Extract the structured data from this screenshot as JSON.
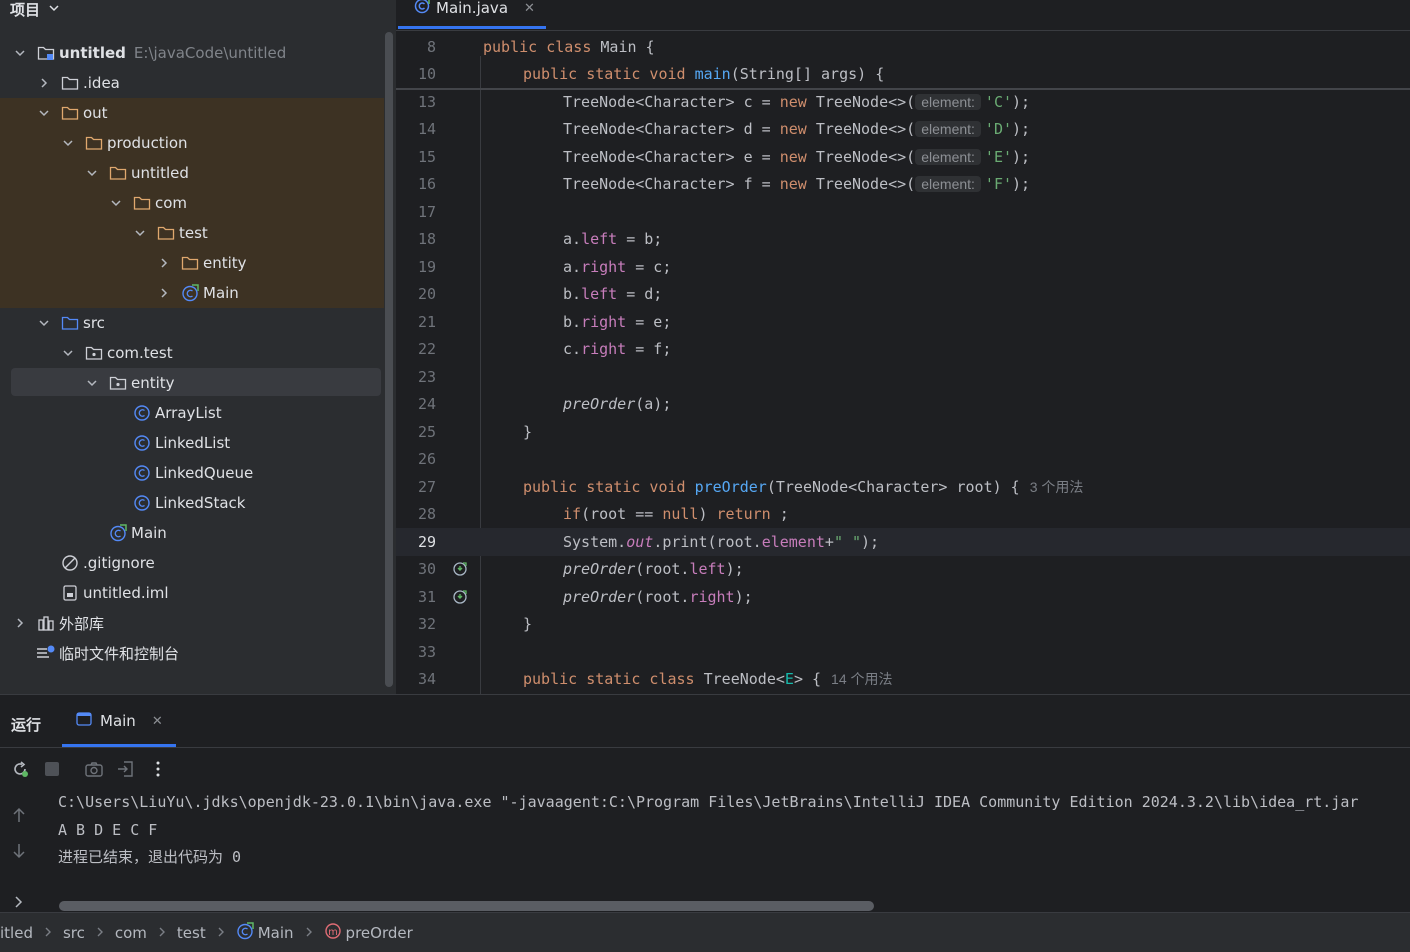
{
  "project_panel": {
    "title": "项目",
    "tree": [
      {
        "label": "untitled",
        "hint": "E:\\javaCode\\untitled",
        "indent": 0,
        "arrow": "down",
        "icon": "module-folder-icon",
        "bold": true
      },
      {
        "label": ".idea",
        "indent": 1,
        "arrow": "right",
        "icon": "folder-icon"
      },
      {
        "label": "out",
        "indent": 1,
        "arrow": "down",
        "icon": "folder-orange-icon",
        "highlight": true
      },
      {
        "label": "production",
        "indent": 2,
        "arrow": "down",
        "icon": "folder-orange-icon",
        "highlight": true
      },
      {
        "label": "untitled",
        "indent": 3,
        "arrow": "down",
        "icon": "folder-orange-icon",
        "highlight": true
      },
      {
        "label": "com",
        "indent": 4,
        "arrow": "down",
        "icon": "folder-orange-icon",
        "highlight": true
      },
      {
        "label": "test",
        "indent": 5,
        "arrow": "down",
        "icon": "folder-orange-icon",
        "highlight": true
      },
      {
        "label": "entity",
        "indent": 6,
        "arrow": "right",
        "icon": "folder-orange-icon",
        "highlight": true
      },
      {
        "label": "Main",
        "indent": 6,
        "arrow": "right",
        "icon": "main-class-icon",
        "highlight": true
      },
      {
        "label": "src",
        "indent": 1,
        "arrow": "down",
        "icon": "source-folder-icon"
      },
      {
        "label": "com.test",
        "indent": 2,
        "arrow": "down",
        "icon": "package-icon"
      },
      {
        "label": "entity",
        "indent": 3,
        "arrow": "down",
        "icon": "package-icon",
        "selected": true
      },
      {
        "label": "ArrayList",
        "indent": 4,
        "arrow": "none",
        "icon": "class-icon"
      },
      {
        "label": "LinkedList",
        "indent": 4,
        "arrow": "none",
        "icon": "class-icon"
      },
      {
        "label": "LinkedQueue",
        "indent": 4,
        "arrow": "none",
        "icon": "class-icon"
      },
      {
        "label": "LinkedStack",
        "indent": 4,
        "arrow": "none",
        "icon": "class-icon"
      },
      {
        "label": "Main",
        "indent": 3,
        "arrow": "none",
        "icon": "main-class-icon"
      },
      {
        "label": ".gitignore",
        "indent": 1,
        "arrow": "none",
        "icon": "ignore-file-icon"
      },
      {
        "label": "untitled.iml",
        "indent": 1,
        "arrow": "none",
        "icon": "iml-file-icon"
      },
      {
        "label": "外部库",
        "indent": 0,
        "arrow": "right",
        "icon": "library-icon"
      },
      {
        "label": "临时文件和控制台",
        "indent": 0,
        "arrow": "none",
        "icon": "scratch-icon"
      }
    ]
  },
  "editor": {
    "tab_label": "Main.java",
    "lines": [
      {
        "n": "8",
        "indent": 0,
        "tokens": [
          [
            "kw",
            "public class "
          ],
          [
            "ct",
            "Main {"
          ]
        ]
      },
      {
        "n": "10",
        "indent": 1,
        "tokens": [
          [
            "kw",
            "public static void "
          ],
          [
            "fn",
            "main"
          ],
          [
            "ct",
            "(String[] args) {"
          ]
        ]
      },
      {
        "n": "13",
        "indent": 2,
        "tokens": [
          [
            "ct",
            "TreeNode<Character> c = "
          ],
          [
            "kw",
            "new "
          ],
          [
            "ct",
            "TreeNode<>("
          ],
          [
            "ih",
            "element:"
          ],
          [
            "str",
            "'C'"
          ],
          [
            "ct",
            ");"
          ]
        ]
      },
      {
        "n": "14",
        "indent": 2,
        "tokens": [
          [
            "ct",
            "TreeNode<Character> d = "
          ],
          [
            "kw",
            "new "
          ],
          [
            "ct",
            "TreeNode<>("
          ],
          [
            "ih",
            "element:"
          ],
          [
            "str",
            "'D'"
          ],
          [
            "ct",
            ");"
          ]
        ]
      },
      {
        "n": "15",
        "indent": 2,
        "tokens": [
          [
            "ct",
            "TreeNode<Character> e = "
          ],
          [
            "kw",
            "new "
          ],
          [
            "ct",
            "TreeNode<>("
          ],
          [
            "ih",
            "element:"
          ],
          [
            "str",
            "'E'"
          ],
          [
            "ct",
            ");"
          ]
        ]
      },
      {
        "n": "16",
        "indent": 2,
        "tokens": [
          [
            "ct",
            "TreeNode<Character> f = "
          ],
          [
            "kw",
            "new "
          ],
          [
            "ct",
            "TreeNode<>("
          ],
          [
            "ih",
            "element:"
          ],
          [
            "str",
            "'F'"
          ],
          [
            "ct",
            ");"
          ]
        ]
      },
      {
        "n": "17",
        "indent": 0,
        "tokens": []
      },
      {
        "n": "18",
        "indent": 2,
        "tokens": [
          [
            "ct",
            "a."
          ],
          [
            "fld",
            "left"
          ],
          [
            "ct",
            " = b;"
          ]
        ]
      },
      {
        "n": "19",
        "indent": 2,
        "tokens": [
          [
            "ct",
            "a."
          ],
          [
            "fld",
            "right"
          ],
          [
            "ct",
            " = c;"
          ]
        ]
      },
      {
        "n": "20",
        "indent": 2,
        "tokens": [
          [
            "ct",
            "b."
          ],
          [
            "fld",
            "left"
          ],
          [
            "ct",
            " = d;"
          ]
        ]
      },
      {
        "n": "21",
        "indent": 2,
        "tokens": [
          [
            "ct",
            "b."
          ],
          [
            "fld",
            "right"
          ],
          [
            "ct",
            " = e;"
          ]
        ]
      },
      {
        "n": "22",
        "indent": 2,
        "tokens": [
          [
            "ct",
            "c."
          ],
          [
            "fld",
            "right"
          ],
          [
            "ct",
            " = f;"
          ]
        ]
      },
      {
        "n": "23",
        "indent": 0,
        "tokens": []
      },
      {
        "n": "24",
        "indent": 2,
        "tokens": [
          [
            "it",
            "preOrder"
          ],
          [
            "ct",
            "(a);"
          ]
        ]
      },
      {
        "n": "25",
        "indent": 1,
        "tokens": [
          [
            "ct",
            "}"
          ]
        ]
      },
      {
        "n": "26",
        "indent": 0,
        "tokens": []
      },
      {
        "n": "27",
        "indent": 1,
        "tokens": [
          [
            "kw",
            "public static void "
          ],
          [
            "fn",
            "preOrder"
          ],
          [
            "ct",
            "(TreeNode<Character> root) {"
          ],
          [
            "usage",
            "3 个用法"
          ]
        ]
      },
      {
        "n": "28",
        "indent": 2,
        "tokens": [
          [
            "kw",
            "if"
          ],
          [
            "ct",
            "(root == "
          ],
          [
            "kw",
            "null"
          ],
          [
            "ct",
            ") "
          ],
          [
            "kw",
            "return"
          ],
          [
            "ct",
            " ;"
          ]
        ]
      },
      {
        "n": "29",
        "indent": 2,
        "current": true,
        "tokens": [
          [
            "ct",
            "System."
          ],
          [
            "fldit",
            "out"
          ],
          [
            "ct",
            ".print(root."
          ],
          [
            "fld",
            "element"
          ],
          [
            "ct",
            "+"
          ],
          [
            "str",
            "\" \""
          ],
          [
            "ct",
            ");"
          ]
        ]
      },
      {
        "n": "30",
        "indent": 2,
        "recursion": true,
        "tokens": [
          [
            "it",
            "preOrder"
          ],
          [
            "ct",
            "(root."
          ],
          [
            "fld",
            "left"
          ],
          [
            "ct",
            ");"
          ]
        ]
      },
      {
        "n": "31",
        "indent": 2,
        "recursion": true,
        "tokens": [
          [
            "it",
            "preOrder"
          ],
          [
            "ct",
            "(root."
          ],
          [
            "fld",
            "right"
          ],
          [
            "ct",
            ");"
          ]
        ]
      },
      {
        "n": "32",
        "indent": 1,
        "tokens": [
          [
            "ct",
            "}"
          ]
        ]
      },
      {
        "n": "33",
        "indent": 0,
        "tokens": []
      },
      {
        "n": "34",
        "indent": 1,
        "tokens": [
          [
            "kw",
            "public static class "
          ],
          [
            "ct",
            "TreeNode<"
          ],
          [
            "tp",
            "E"
          ],
          [
            "ct",
            "> {"
          ],
          [
            "usage",
            "14 个用法"
          ]
        ]
      }
    ]
  },
  "run_panel": {
    "title": "运行",
    "tab_label": "Main",
    "console": [
      "C:\\Users\\LiuYu\\.jdks\\openjdk-23.0.1\\bin\\java.exe \"-javaagent:C:\\Program Files\\JetBrains\\IntelliJ IDEA Community Edition 2024.3.2\\lib\\idea_rt.jar",
      "A B D E C F ",
      "进程已结束，退出代码为 0"
    ]
  },
  "status_bar": {
    "breadcrumbs": [
      "itled",
      "src",
      "com",
      "test",
      "Main",
      "preOrder"
    ]
  }
}
